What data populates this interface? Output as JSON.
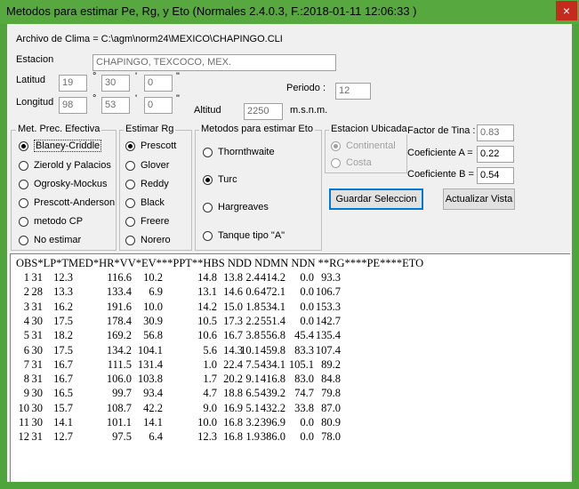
{
  "window": {
    "title": "Metodos para estimar Pe, Rg, y Eto (Normales 2.4.0.3, F.:2018-01-11 12:06:33  )",
    "close_label": "×"
  },
  "archivo": {
    "label": "Archivo de Clima = C:\\agm\\norm24\\MEXICO\\CHAPINGO.CLI"
  },
  "estacion": {
    "label": "Estacion",
    "value": "CHAPINGO, TEXCOCO, MEX."
  },
  "latitud": {
    "label": "Latitud",
    "deg": "19",
    "min": "30",
    "sec": "0"
  },
  "longitud": {
    "label": "Longitud",
    "deg": "98",
    "min": "53",
    "sec": "0"
  },
  "units": {
    "deg": "°",
    "min": "'",
    "sec": "\""
  },
  "periodo": {
    "label": "Periodo :",
    "value": "12"
  },
  "altitud": {
    "label": "Altitud",
    "value": "2250",
    "unit": "m.s.n.m."
  },
  "pe_group": {
    "title": "Met. Prec. Efectiva",
    "options": [
      "Blaney-Criddle",
      "Zierold y Palacios",
      "Ogrosky-Mockus",
      "Prescott-Anderson",
      "metodo CP",
      "No estimar"
    ]
  },
  "rg_group": {
    "title": "Estimar Rg",
    "options": [
      "Prescott",
      "Glover",
      "Reddy",
      "Black",
      "Freere",
      "Norero"
    ]
  },
  "eto_group": {
    "title": "Metodos para estimar Eto",
    "options": [
      "Thornthwaite",
      "Turc",
      "Hargreaves",
      "Tanque tipo \"A\""
    ]
  },
  "ubicada_group": {
    "title": "Estacion Ubicada",
    "options": [
      "Continental",
      "Costa"
    ]
  },
  "factor_tina": {
    "label": "Factor de Tina :",
    "value": "0.83"
  },
  "coef_a": {
    "label": "Coeficiente A =",
    "value": "0.22"
  },
  "coef_b": {
    "label": "Coeficiente B =",
    "value": "0.54"
  },
  "buttons": {
    "guardar": "Guardar Seleccion",
    "actualizar": "Actualizar Vista"
  },
  "output": {
    "header": "OBS*LP*TMED*HR*VV*EV***PPT**HBS NDD NDMN NDN **RG****PE****ETO",
    "rows": [
      [
        "1",
        "31",
        "12.3",
        "116.6",
        "10.2",
        "14.8",
        "13.8",
        "2.4",
        "414.2",
        "0.0",
        "93.3"
      ],
      [
        "2",
        "28",
        "13.3",
        "133.4",
        "6.9",
        "13.1",
        "14.6",
        "0.6",
        "472.1",
        "0.0",
        "106.7"
      ],
      [
        "3",
        "31",
        "16.2",
        "191.6",
        "10.0",
        "14.2",
        "15.0",
        "1.8",
        "534.1",
        "0.0",
        "153.3"
      ],
      [
        "4",
        "30",
        "17.5",
        "178.4",
        "30.9",
        "10.5",
        "17.3",
        "2.2",
        "551.4",
        "0.0",
        "142.7"
      ],
      [
        "5",
        "31",
        "18.2",
        "169.2",
        "56.8",
        "10.6",
        "16.7",
        "3.8",
        "556.8",
        "45.4",
        "135.4"
      ],
      [
        "6",
        "30",
        "17.5",
        "134.2",
        "104.1",
        "5.6",
        "14.3",
        "10.1",
        "459.8",
        "83.3",
        "107.4"
      ],
      [
        "7",
        "31",
        "16.7",
        "111.5",
        "131.4",
        "1.0",
        "22.4",
        "7.5",
        "434.1",
        "105.1",
        "89.2"
      ],
      [
        "8",
        "31",
        "16.7",
        "106.0",
        "103.8",
        "1.7",
        "20.2",
        "9.1",
        "416.8",
        "83.0",
        "84.8"
      ],
      [
        "9",
        "30",
        "16.5",
        "99.7",
        "93.4",
        "4.7",
        "18.8",
        "6.5",
        "439.2",
        "74.7",
        "79.8"
      ],
      [
        "10",
        "30",
        "15.7",
        "108.7",
        "42.2",
        "9.0",
        "16.9",
        "5.1",
        "432.2",
        "33.8",
        "87.0"
      ],
      [
        "11",
        "30",
        "14.1",
        "101.1",
        "14.1",
        "10.0",
        "16.8",
        "3.2",
        "396.9",
        "0.0",
        "80.9"
      ],
      [
        "12",
        "31",
        "12.7",
        "97.5",
        "6.4",
        "12.3",
        "16.8",
        "1.9",
        "386.0",
        "0.0",
        "78.0"
      ]
    ]
  }
}
